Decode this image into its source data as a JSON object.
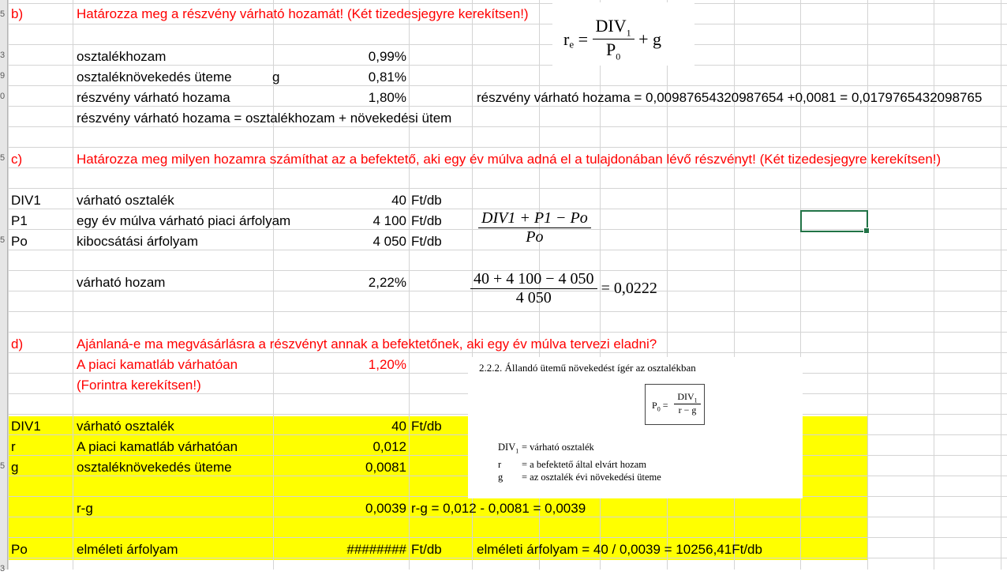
{
  "row_headers": [
    "5",
    "",
    "3",
    "9",
    "0",
    "",
    "",
    "5",
    "",
    "",
    "",
    "5",
    "",
    "",
    "",
    "",
    "",
    "",
    "",
    "",
    "",
    "",
    "5",
    "",
    "",
    "",
    "",
    "3"
  ],
  "sections": {
    "b": {
      "label": "b)",
      "title": "Határozza meg a részvény várható hozamát! (Két tizedesjegyre kerekítsen!)",
      "rows": [
        {
          "label": "osztalékhozam",
          "sym": "",
          "value": "0,99%"
        },
        {
          "label": "osztaléknövekedés üteme",
          "sym": "g",
          "value": "0,81%"
        },
        {
          "label": "részvény várható hozama",
          "sym": "",
          "value": "1,80%"
        }
      ],
      "calc_note": "részvény várható hozama = 0,00987654320987654 +0,0081 = 0,0179765432098765",
      "formula_text": "részvény várható hozama = osztalékhozam + növekedési ütem",
      "formula_image": {
        "lhs": "r",
        "lhs_sub": "e",
        "num": "DIV",
        "num_sub": "1",
        "den": "P",
        "den_sub": "0",
        "tail": "+ g"
      }
    },
    "c": {
      "label": "c)",
      "title": "Határozza meg milyen hozamra számíthat az a befektető, aki egy év múlva adná el a tulajdonában lévő részvényt! (Két tizedesjegyre kerekítsen!)",
      "rows": [
        {
          "code": "DIV1",
          "label": "várható osztalék",
          "value": "40",
          "unit": "Ft/db"
        },
        {
          "code": "P1",
          "label": "egy év múlva várható piaci árfolyam",
          "value": "4 100",
          "unit": "Ft/db"
        },
        {
          "code": "Po",
          "label": "kibocsátási árfolyam",
          "value": "4 050",
          "unit": "Ft/db"
        }
      ],
      "expected_label": "várható hozam",
      "expected_value": "2,22%",
      "eq1_num": "DIV1 + P1 − Po",
      "eq1_den": "Po",
      "eq2_num": "40 + 4 100 − 4 050",
      "eq2_den": "4 050",
      "eq2_result": "= 0,0222"
    },
    "d": {
      "label": "d)",
      "title": "Ajánlaná-e ma megvásárlásra a részvényt annak a befektetőnek, aki egy év múlva tervezi eladni?",
      "rate_label": "A piaci kamatláb várhatóan",
      "rate_value": "1,20%",
      "round_note": "(Forintra kerekítsen!)",
      "rows": [
        {
          "code": "DIV1",
          "label": "várható osztalék",
          "value": "40",
          "unit": "Ft/db"
        },
        {
          "code": "r",
          "label": "A piaci kamatláb várhatóan",
          "value": "0,012",
          "unit": ""
        },
        {
          "code": "g",
          "label": "osztaléknövekedés üteme",
          "value": "0,0081",
          "unit": ""
        }
      ],
      "rg_label": "r-g",
      "rg_value": "0,0039",
      "rg_note": "r-g = 0,012 - 0,0081 = 0,0039",
      "po_code": "Po",
      "po_label": "elméleti árfolyam",
      "po_value": "########",
      "po_unit": "Ft/db",
      "po_note": "elméleti árfolyam = 40 / 0,0039 = 10256,41Ft/db"
    }
  },
  "book_excerpt": {
    "heading": "2.2.2. Állandó ütemű növekedést ígér az osztalékban",
    "formula_lhs": "P",
    "formula_lhs_sub": "0",
    "formula_num": "DIV",
    "formula_num_sub": "1",
    "formula_den": "r − g",
    "legend": [
      {
        "sym": "DIV",
        "sub": "1",
        "text": "= várható osztalék"
      },
      {
        "sym": "r",
        "sub": "",
        "text": "= a befektető által elvárt hozam"
      },
      {
        "sym": "g",
        "sub": "",
        "text": "= az osztalék évi növekedési üteme"
      }
    ]
  },
  "colors": {
    "red": "#ff0000",
    "highlight": "#ffff00",
    "selection": "#217346"
  }
}
